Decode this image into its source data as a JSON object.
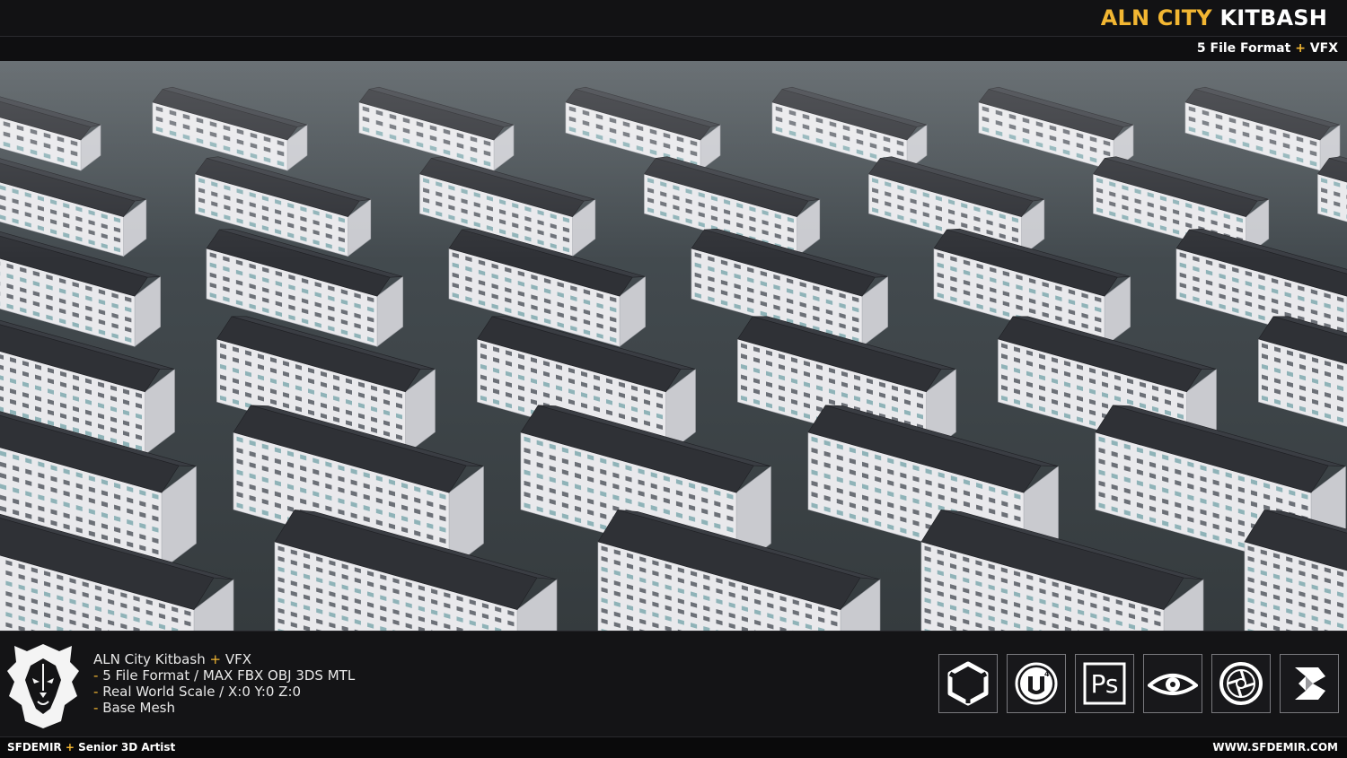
{
  "header": {
    "brand_accent": "ALN CITY",
    "brand_main": "KITBASH",
    "subtitle_left": "5 File Format",
    "subtitle_plus": "+",
    "subtitle_right": "VFX"
  },
  "features": {
    "title_left": "ALN City Kitbash",
    "title_plus": "+",
    "title_right": "VFX",
    "items": [
      "5 File Format / MAX FBX OBJ 3DS MTL",
      "Real World Scale / X:0 Y:0 Z:0",
      "Base Mesh"
    ],
    "dash": "-"
  },
  "software_icons": [
    "unity-icon",
    "unreal-engine-icon",
    "photoshop-icon",
    "eye-icon",
    "keyshot-icon",
    "3ds-max-icon"
  ],
  "photoshop_label": "Ps",
  "footer": {
    "artist": "SFDEMIR",
    "plus": "+",
    "role": "Senior 3D Artist",
    "website": "WWW.SFDEMIR.COM"
  },
  "colors": {
    "accent": "#f2b632",
    "background": "#0d0d0f",
    "water": "#3e4548",
    "roof": "#2f3136",
    "wall": "#e9e9ec"
  }
}
